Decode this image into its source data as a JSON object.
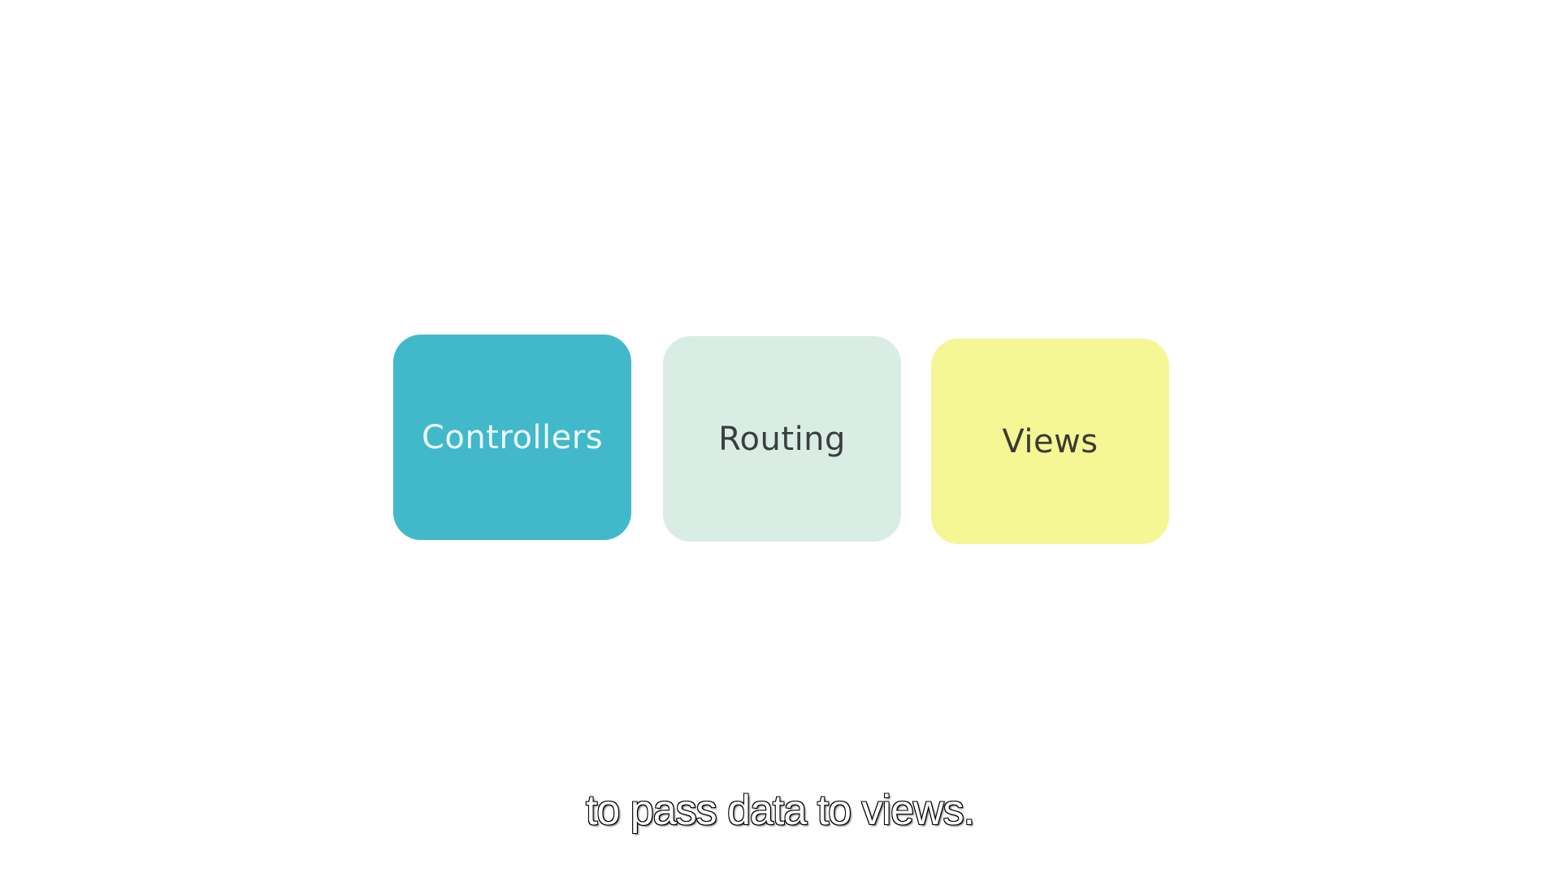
{
  "cards": [
    {
      "label": "Controllers",
      "color": "#42b8cb"
    },
    {
      "label": "Routing",
      "color": "#d9ede5"
    },
    {
      "label": "Views",
      "color": "#f5f694"
    }
  ],
  "subtitle": "to pass data to views."
}
